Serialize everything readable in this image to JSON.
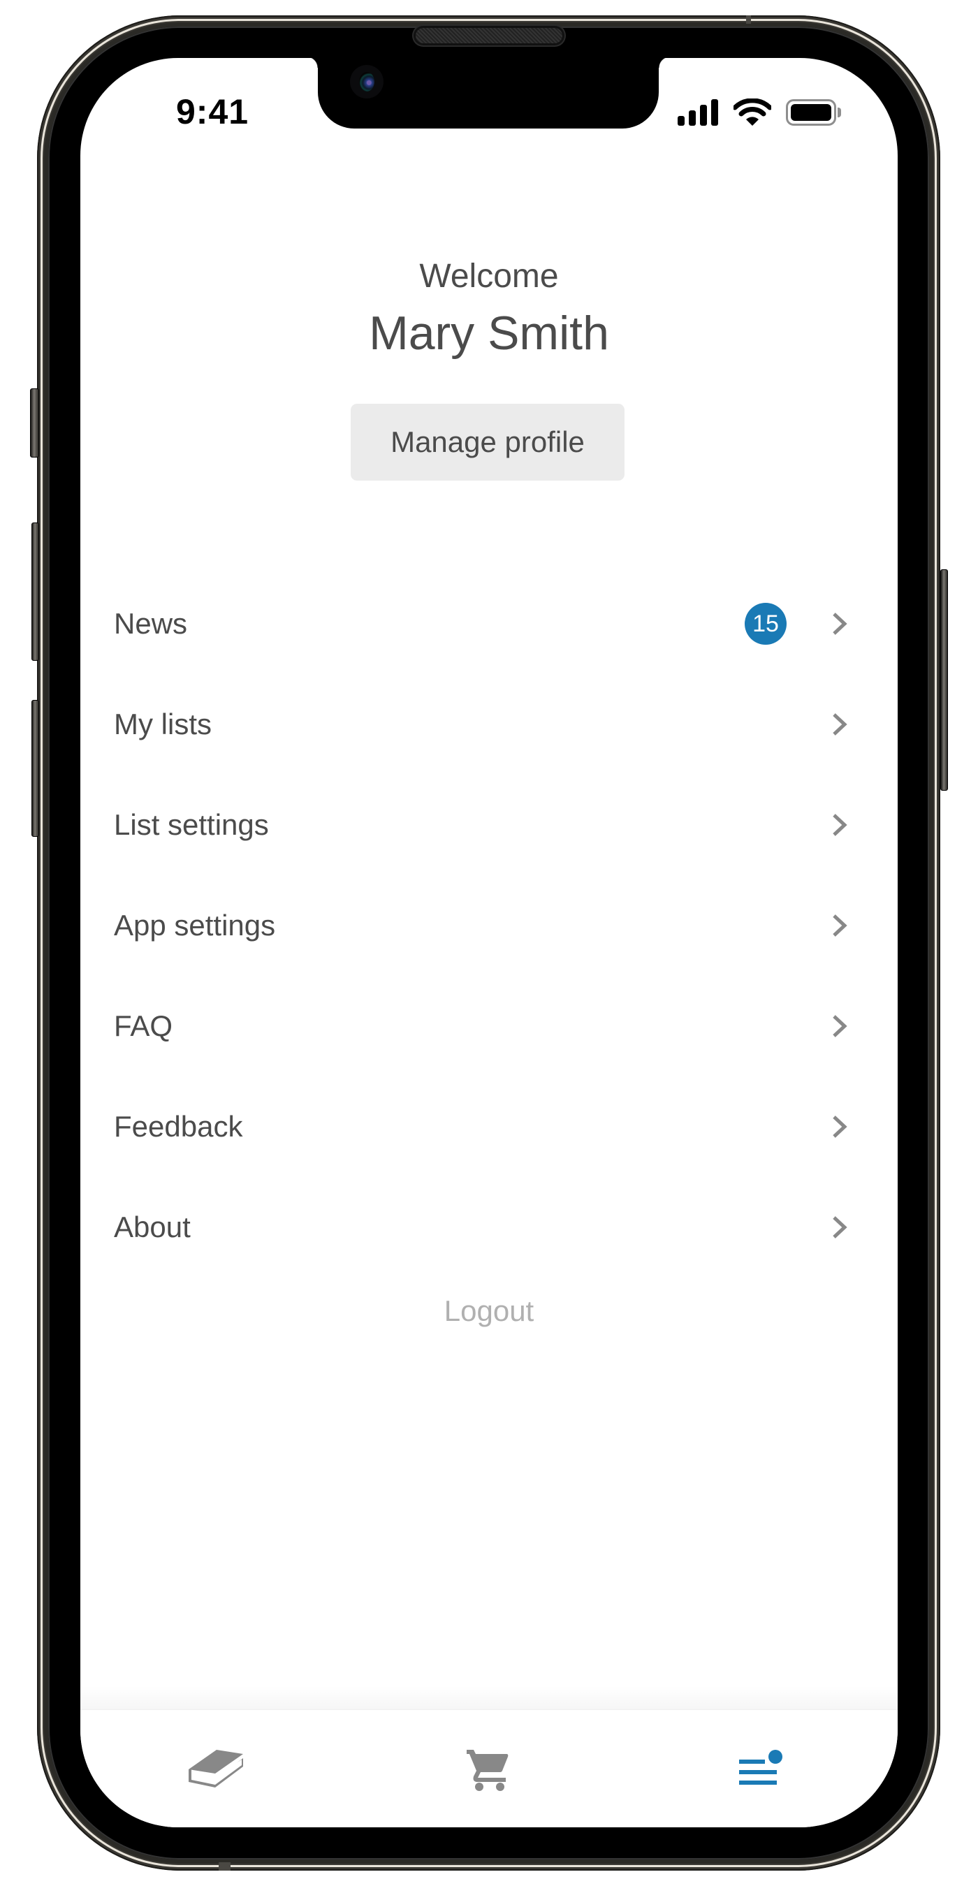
{
  "status_bar": {
    "time": "9:41",
    "icons": [
      "cellular-signal-icon",
      "wifi-icon",
      "battery-icon"
    ]
  },
  "header": {
    "welcome": "Welcome",
    "user_name": "Mary Smith",
    "manage_profile_label": "Manage profile"
  },
  "menu": {
    "items": [
      {
        "label": "News",
        "badge": "15",
        "icon": "chevron-right-icon"
      },
      {
        "label": "My lists",
        "icon": "chevron-right-icon"
      },
      {
        "label": "List settings",
        "icon": "chevron-right-icon"
      },
      {
        "label": "App settings",
        "icon": "chevron-right-icon"
      },
      {
        "label": "FAQ",
        "icon": "chevron-right-icon"
      },
      {
        "label": "Feedback",
        "icon": "chevron-right-icon"
      },
      {
        "label": "About",
        "icon": "chevron-right-icon"
      }
    ],
    "logout_label": "Logout"
  },
  "bottom_nav": {
    "items": [
      {
        "icon": "book-icon",
        "active": false
      },
      {
        "icon": "shopping-cart-icon",
        "active": false
      },
      {
        "icon": "menu-icon",
        "active": true,
        "has_notification_dot": true
      }
    ]
  },
  "colors": {
    "accent": "#1a7ab5",
    "text": "#4b4b4b",
    "muted": "#b0b0b0",
    "icon_inactive": "#888888",
    "button_bg": "#ebebeb"
  }
}
